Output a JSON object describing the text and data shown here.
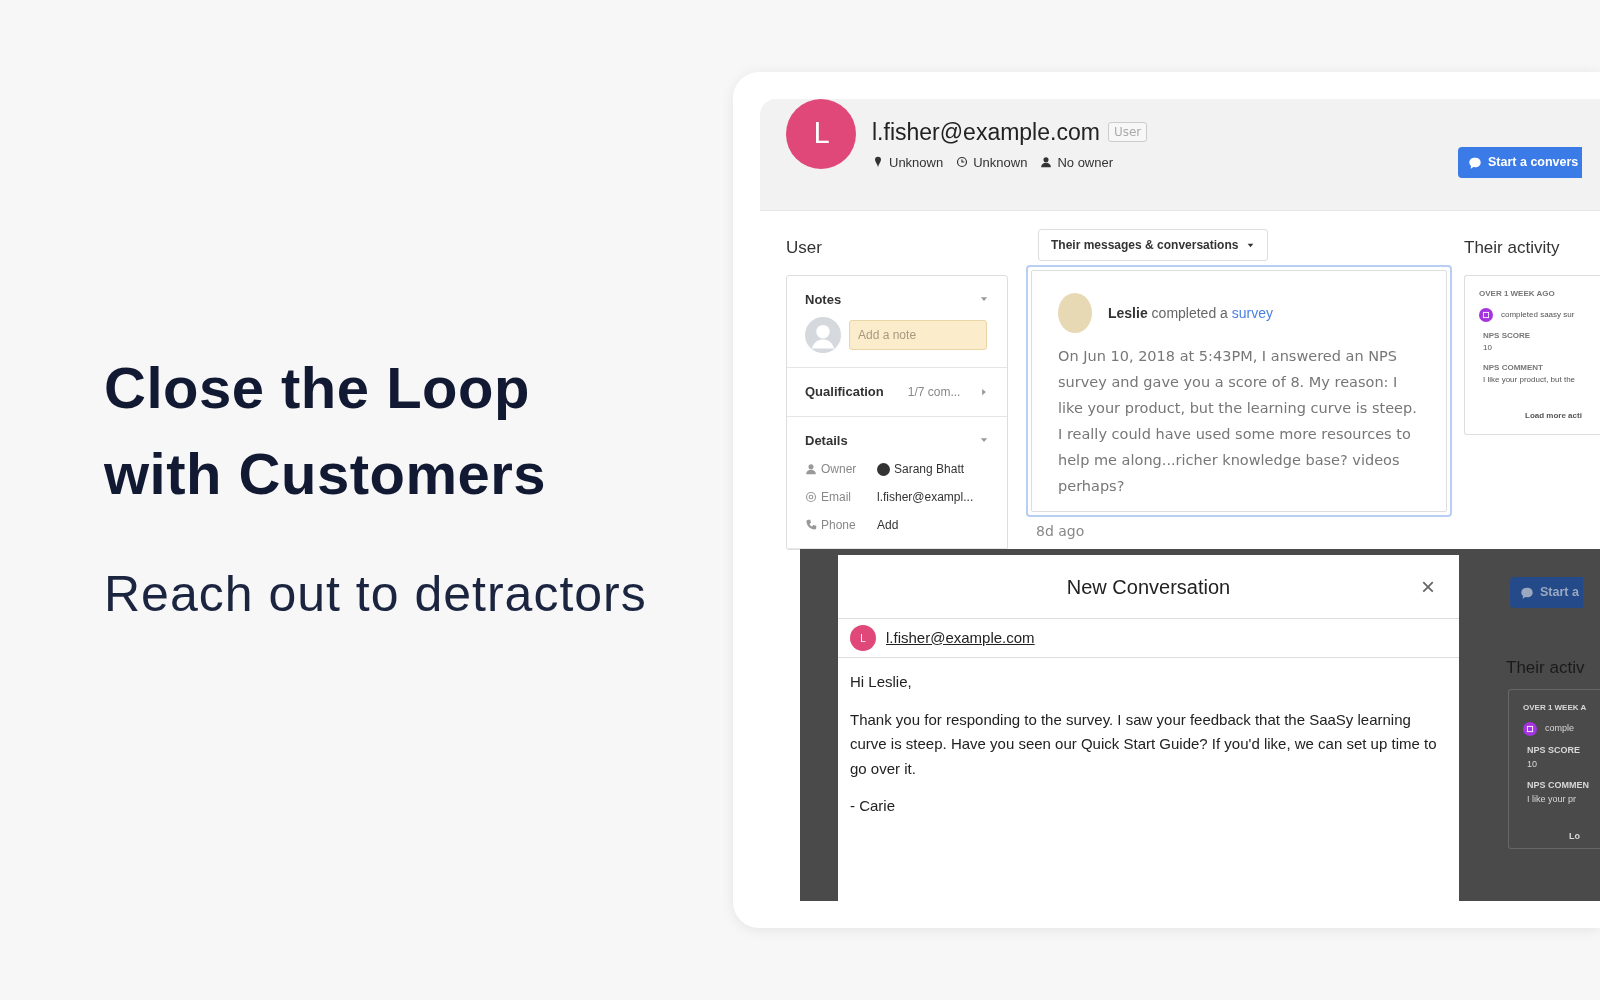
{
  "hero": {
    "title_lines": [
      "Close the Loop",
      "with Customers"
    ],
    "subtitle": "Reach out to detractors"
  },
  "profile": {
    "avatar_letter": "L",
    "email": "l.fisher@example.com",
    "role_badge": "User",
    "meta": [
      {
        "kind": "location",
        "text": "Unknown"
      },
      {
        "kind": "time",
        "text": "Unknown"
      },
      {
        "kind": "owner",
        "text": "No owner"
      }
    ],
    "action_button": "Start a convers"
  },
  "user_panel": {
    "title": "User",
    "sections": [
      {
        "kind": "notes",
        "title": "Notes",
        "expanded": true,
        "placeholder": "Add a note"
      },
      {
        "kind": "qualification",
        "title": "Qualification",
        "value": "1/7 com...",
        "expanded": false
      },
      {
        "kind": "details",
        "title": "Details",
        "expanded": true,
        "rows": [
          {
            "kind": "owner",
            "label": "Owner",
            "value": "Sarang Bhatt"
          },
          {
            "kind": "email",
            "label": "Email",
            "value": "l.fisher@exampl..."
          },
          {
            "kind": "phone",
            "label": "Phone",
            "value": "Add"
          }
        ]
      }
    ]
  },
  "messages": {
    "filter": "Their messages & conversations",
    "actor": "Leslie",
    "action": "completed a",
    "link": "survey",
    "body": "On Jun 10, 2018 at 5:43PM, I answered an NPS survey and gave you a score of 8. My reason: I like your product, but the learning curve is steep. I really could have used some more resources to help me along...richer knowledge base? videos perhaps?",
    "time": "8d ago"
  },
  "activity": {
    "title": "Their activity",
    "group": "OVER 1 WEEK AGO",
    "event": "completed saasy sur",
    "fields": [
      {
        "label": "NPS SCORE",
        "value": "10"
      },
      {
        "label": "NPS COMMENT",
        "value": "I like your product, but the"
      }
    ],
    "load_more": "Load more acti"
  },
  "dimmed_background": {
    "action_button": "Start a",
    "activity_title": "Their activ",
    "group": "OVER 1 WEEK A",
    "event": "comple",
    "fields": [
      {
        "label": "NPS SCORE",
        "value": "10"
      },
      {
        "label": "NPS COMMEN",
        "value": "I like your pr"
      }
    ],
    "load_more": "Lo"
  },
  "modal": {
    "title": "New Conversation",
    "close": "×",
    "recipient_letter": "L",
    "recipient": "l.fisher@example.com",
    "body": [
      "Hi Leslie,",
      "Thank you for responding to the survey. I saw your feedback that the SaaSy learning curve is steep. Have you seen our Quick Start Guide? If you'd like, we can set up time to go over it.",
      "- Carie"
    ]
  }
}
